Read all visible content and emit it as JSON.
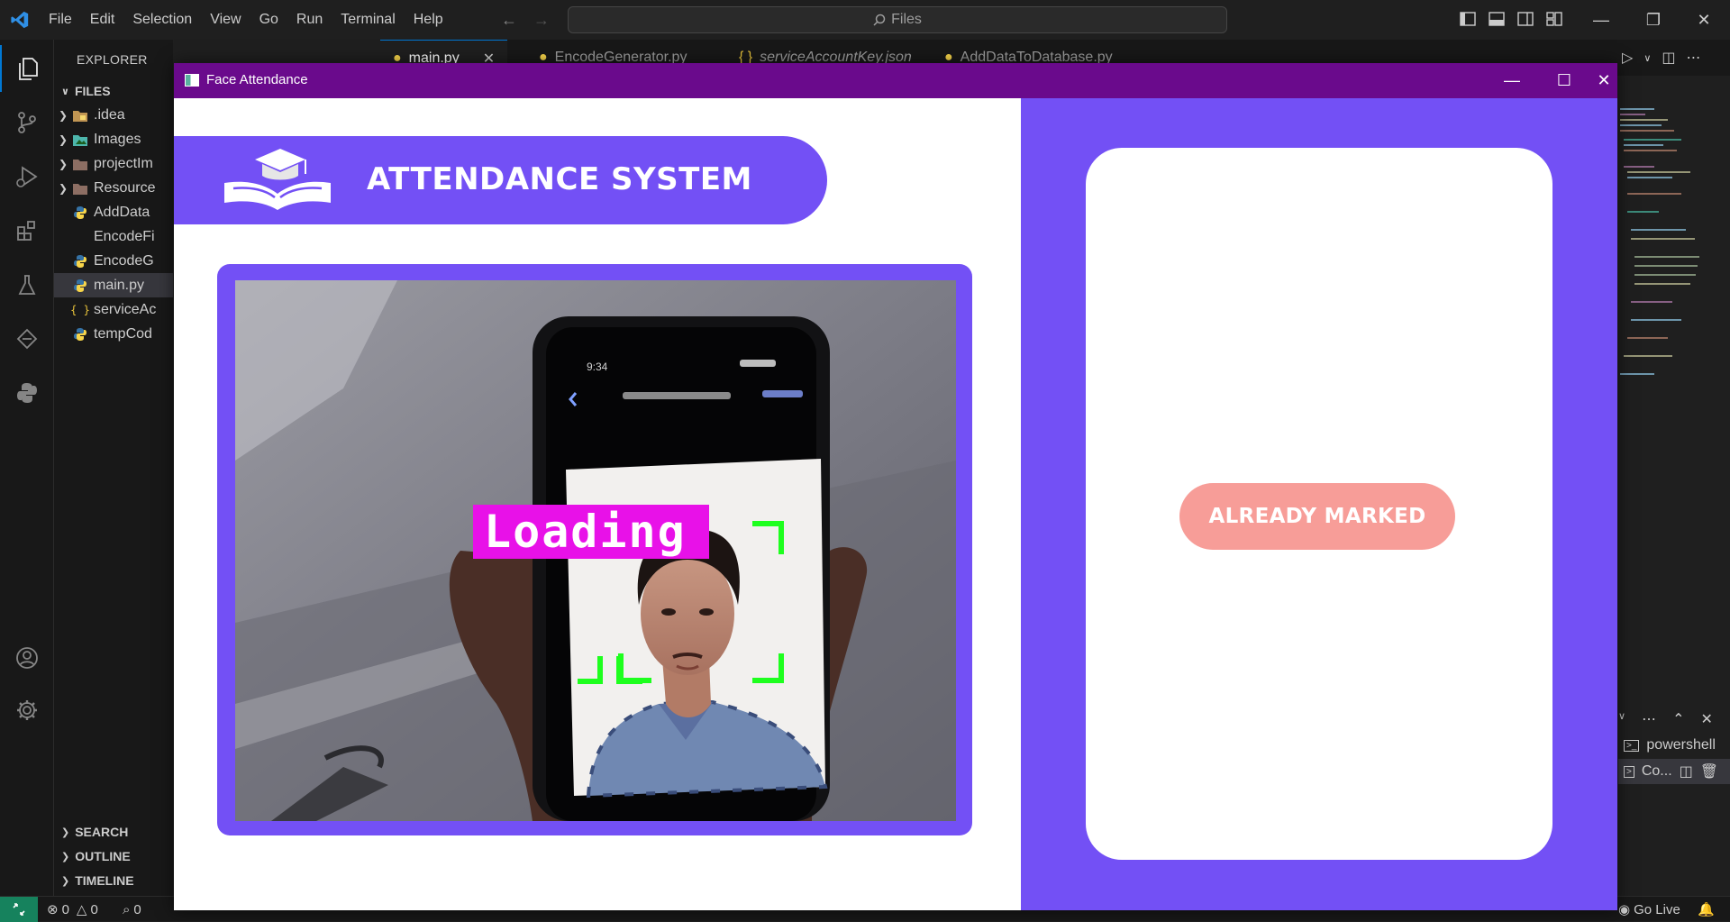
{
  "vscode": {
    "menu": [
      "File",
      "Edit",
      "Selection",
      "View",
      "Go",
      "Run",
      "Terminal",
      "Help"
    ],
    "search_placeholder": "Files",
    "explorer_title": "EXPLORER",
    "files_section": "FILES",
    "tree": [
      {
        "label": ".idea",
        "type": "folder",
        "icon": "folder-idea-icon"
      },
      {
        "label": "Images",
        "type": "folder",
        "icon": "folder-images-icon"
      },
      {
        "label": "projectIm",
        "type": "folder",
        "icon": "folder-icon"
      },
      {
        "label": "Resource",
        "type": "folder",
        "icon": "folder-icon"
      },
      {
        "label": "AddData",
        "type": "file",
        "icon": "python-file-icon"
      },
      {
        "label": "EncodeFi",
        "type": "file",
        "icon": "file-icon"
      },
      {
        "label": "EncodeG",
        "type": "file",
        "icon": "python-file-icon"
      },
      {
        "label": "main.py",
        "type": "file",
        "icon": "python-file-icon",
        "selected": true
      },
      {
        "label": "serviceAc",
        "type": "file",
        "icon": "json-file-icon"
      },
      {
        "label": "tempCod",
        "type": "file",
        "icon": "python-file-icon"
      }
    ],
    "bottom_sections": [
      "SEARCH",
      "OUTLINE",
      "TIMELINE"
    ],
    "tabs": [
      {
        "label": "main.py",
        "active": true
      },
      {
        "label": "EncodeGenerator.py",
        "active": false
      },
      {
        "label": "serviceAccountKey.json",
        "active": false
      },
      {
        "label": "AddDataToDatabase.py",
        "active": false
      }
    ],
    "terminal_items": [
      "powershell",
      "Co..."
    ],
    "status": {
      "errors": "0",
      "warnings": "0",
      "ports": "0",
      "go_live": "Go Live"
    }
  },
  "app": {
    "window_title": "Face Attendance",
    "banner_title": "ATTENDANCE SYSTEM",
    "overlay_label": "Loading",
    "status_label": "ALREADY MARKED",
    "colors": {
      "title_bar": "#6a0a8c",
      "accent": "#7350f5",
      "loading_bg": "#e811e8",
      "face_box": "#1eff1e",
      "status_pill": "#f79d98"
    }
  }
}
